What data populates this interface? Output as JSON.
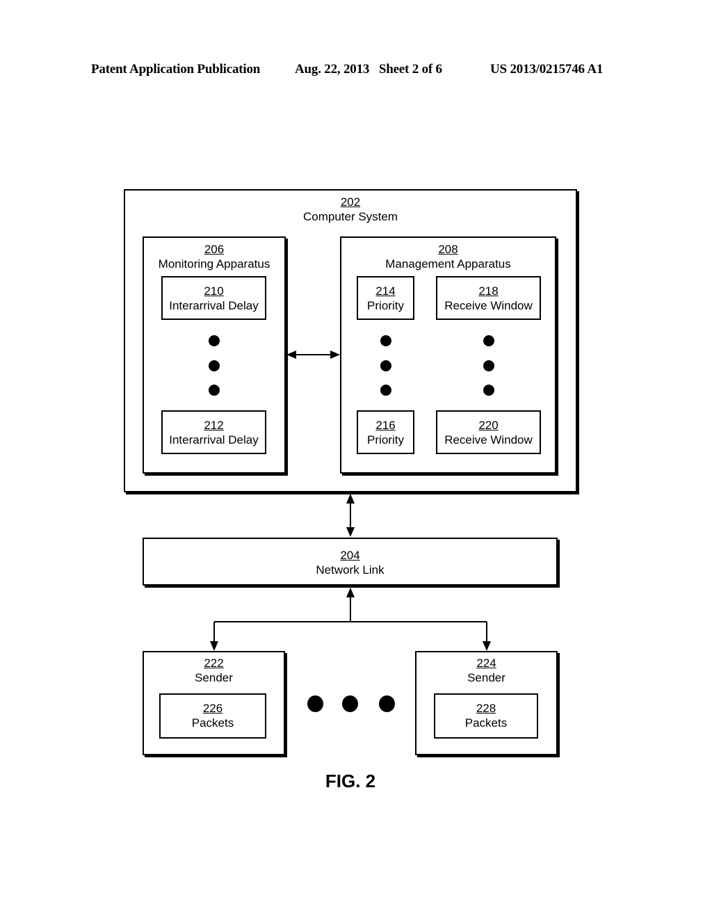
{
  "header": {
    "publication": "Patent Application Publication",
    "date_sheet": "Aug. 22, 2013   Sheet 2 of 6",
    "patent_number": "US 2013/0215746 A1"
  },
  "diagram": {
    "computer_system": {
      "num": "202",
      "label": "Computer System"
    },
    "monitoring_apparatus": {
      "num": "206",
      "label": "Monitoring Apparatus"
    },
    "interarrival_delay_1": {
      "num": "210",
      "label": "Interarrival Delay"
    },
    "interarrival_delay_2": {
      "num": "212",
      "label": "Interarrival Delay"
    },
    "management_apparatus": {
      "num": "208",
      "label": "Management Apparatus"
    },
    "priority_1": {
      "num": "214",
      "label": "Priority"
    },
    "priority_2": {
      "num": "216",
      "label": "Priority"
    },
    "receive_window_1": {
      "num": "218",
      "label": "Receive Window"
    },
    "receive_window_2": {
      "num": "220",
      "label": "Receive Window"
    },
    "network_link": {
      "num": "204",
      "label": "Network Link"
    },
    "sender_1": {
      "num": "222",
      "label": "Sender"
    },
    "packets_1": {
      "num": "226",
      "label": "Packets"
    },
    "sender_2": {
      "num": "224",
      "label": "Sender"
    },
    "packets_2": {
      "num": "228",
      "label": "Packets"
    }
  },
  "caption": "FIG. 2"
}
